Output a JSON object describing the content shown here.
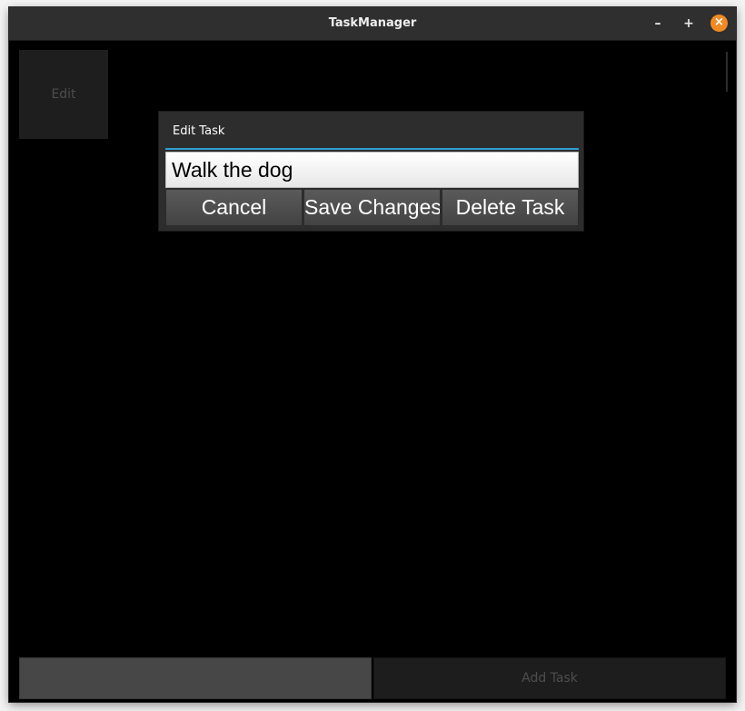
{
  "window": {
    "title": "TaskManager",
    "minimize_symbol": "–",
    "maximize_symbol": "+",
    "close_symbol": "×"
  },
  "task_tile": {
    "label": "Edit"
  },
  "edit_dialog": {
    "title": "Edit Task",
    "task_value": "Walk the dog",
    "cancel_label": "Cancel",
    "save_label": "Save Changes",
    "delete_label": "Delete Task"
  },
  "footer": {
    "new_task_value": "",
    "add_task_label": "Add Task"
  },
  "colors": {
    "accent": "#2f9fd0",
    "close_button": "#f08a24",
    "background": "#000000"
  }
}
